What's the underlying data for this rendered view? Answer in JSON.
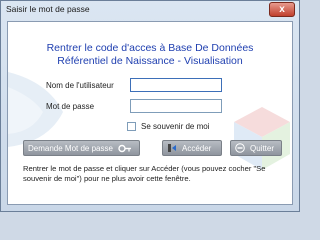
{
  "window": {
    "title": "Saisir le mot de passe",
    "close_glyph": "x"
  },
  "heading": {
    "line1": "Rentrer le code d'acces à Base De Données",
    "line2": "Référentiel de Naissance - Visualisation"
  },
  "form": {
    "username_label": "Nom de l'utilisateur",
    "username_value": "",
    "password_label": "Mot de passe",
    "password_value": "",
    "remember_label": "Se souvenir de moi",
    "remember_checked": false
  },
  "buttons": {
    "request_password": "Demande Mot de passe",
    "access": "Accéder",
    "quit": "Quitter"
  },
  "info_text": "Rentrer le mot de passe et cliquer sur Accéder (vous pouvez cocher \"Se souvenir de moi\") pour ne plus avoir cette fenêtre.",
  "icons": [
    "key-icon",
    "access-icon",
    "minus-icon",
    "close-icon"
  ]
}
